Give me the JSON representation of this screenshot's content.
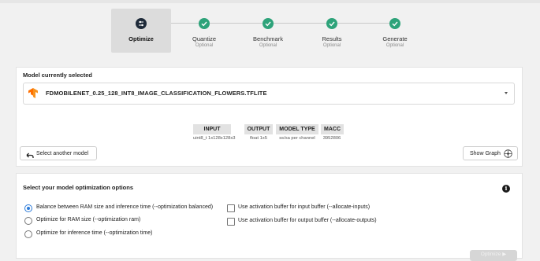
{
  "stepper": {
    "steps": [
      {
        "label": "Optimize",
        "sub": "",
        "state": "active",
        "icon": "sliders-icon"
      },
      {
        "label": "Quantize",
        "sub": "Optional",
        "state": "done",
        "icon": "check-icon"
      },
      {
        "label": "Benchmark",
        "sub": "Optional",
        "state": "done",
        "icon": "check-icon"
      },
      {
        "label": "Results",
        "sub": "Optional",
        "state": "done",
        "icon": "check-icon"
      },
      {
        "label": "Generate",
        "sub": "Optional",
        "state": "done",
        "icon": "check-icon"
      }
    ]
  },
  "model_card": {
    "title": "Model currently selected",
    "model_name": "FDMOBILENET_0.25_128_INT8_IMAGE_CLASSIFICATION_FLOWERS.TFLITE",
    "info": [
      {
        "head": "INPUT",
        "value": "uint8_t 1x128x128x3"
      },
      {
        "head": "OUTPUT",
        "value": "float 1x5"
      },
      {
        "head": "MODEL TYPE",
        "value": "ss/sa per channel"
      },
      {
        "head": "MACC",
        "value": "3952806"
      }
    ],
    "select_another_label": "Select another model",
    "show_graph_label": "Show Graph"
  },
  "options_card": {
    "title": "Select your model optimization options",
    "radios": [
      {
        "label": "Balance between RAM size and inference time (--optimization balanced)",
        "checked": true
      },
      {
        "label": "Optimize for RAM size (--optimization ram)",
        "checked": false
      },
      {
        "label": "Optimize for inference time (--optimization time)",
        "checked": false
      }
    ],
    "checkboxes": [
      {
        "label": "Use activation buffer for input buffer (--allocate-inputs)",
        "checked": false
      },
      {
        "label": "Use activation buffer for output buffer (--allocate-outputs)",
        "checked": false
      }
    ],
    "optimize_label": "Optimize ▶"
  },
  "colors": {
    "accent": "#2b7bd9",
    "done": "#2ea37a",
    "active_step": "#1f2b3a"
  }
}
